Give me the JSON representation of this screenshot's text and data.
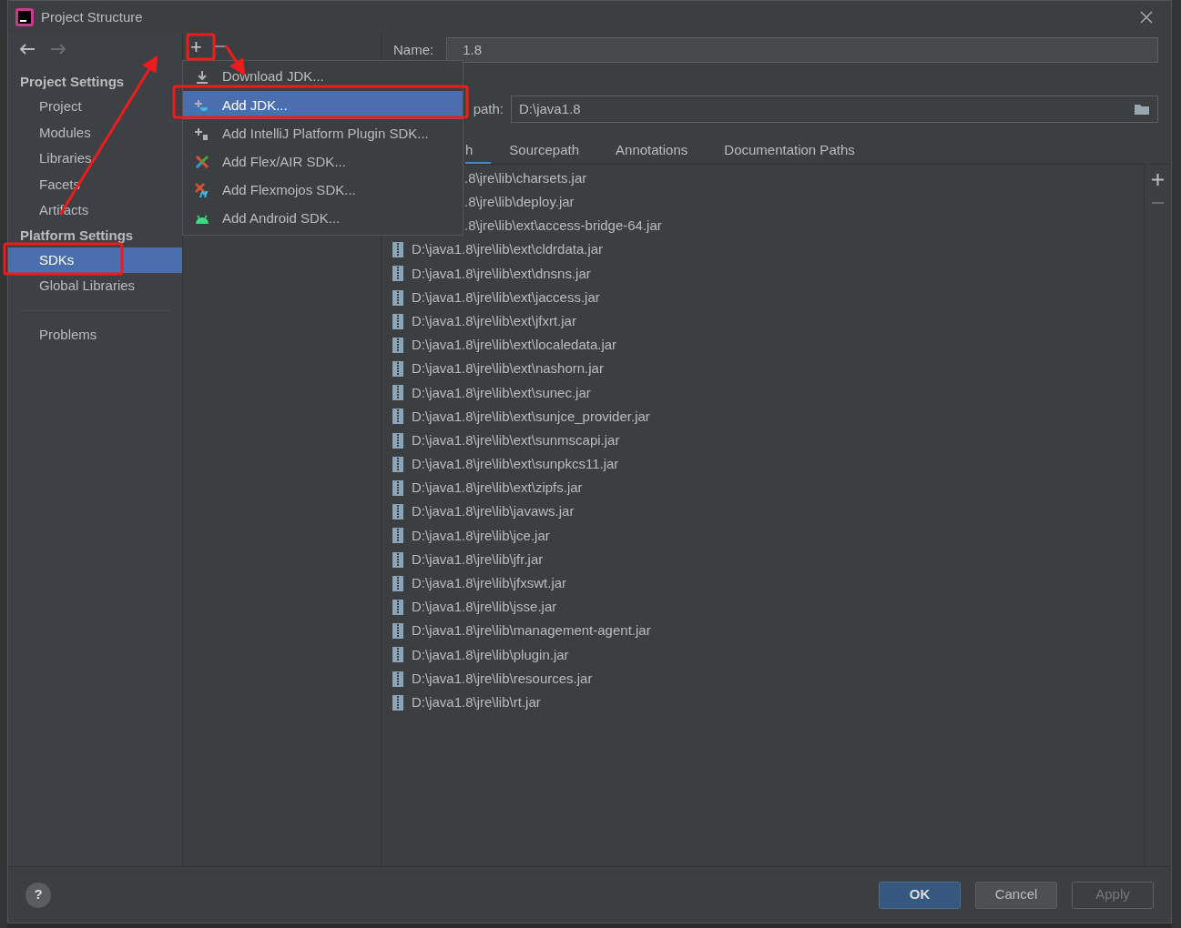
{
  "window": {
    "title": "Project Structure"
  },
  "sidebar": {
    "sections": [
      {
        "title": "Project Settings",
        "items": [
          {
            "label": "Project",
            "selected": false
          },
          {
            "label": "Modules",
            "selected": false
          },
          {
            "label": "Libraries",
            "selected": false
          },
          {
            "label": "Facets",
            "selected": false
          },
          {
            "label": "Artifacts",
            "selected": false
          }
        ]
      },
      {
        "title": "Platform Settings",
        "items": [
          {
            "label": "SDKs",
            "selected": true
          },
          {
            "label": "Global Libraries",
            "selected": false
          }
        ]
      }
    ],
    "bottom_items": [
      {
        "label": "Problems",
        "selected": false
      }
    ]
  },
  "toolbar": {
    "add": "+"
  },
  "add_menu": [
    {
      "label": "Download JDK...",
      "kind": "download",
      "selected": false
    },
    {
      "label": "Add JDK...",
      "kind": "jdk",
      "selected": true
    },
    {
      "label": "Add IntelliJ Platform Plugin SDK...",
      "kind": "plugin",
      "selected": false
    },
    {
      "label": "Add Flex/AIR SDK...",
      "kind": "flex",
      "selected": false
    },
    {
      "label": "Add Flexmojos SDK...",
      "kind": "flexmojos",
      "selected": false
    },
    {
      "label": "Add Android SDK...",
      "kind": "android",
      "selected": false
    }
  ],
  "help": "?",
  "sdk": {
    "name_label": "Name:",
    "name": "1.8",
    "path_label": "path:",
    "path": "D:\\java1.8"
  },
  "tabs": [
    {
      "label": "h",
      "selected": true
    },
    {
      "label": "Sourcepath",
      "selected": false
    },
    {
      "label": "Annotations",
      "selected": false
    },
    {
      "label": "Documentation Paths",
      "selected": false
    }
  ],
  "classpath": [
    {
      "kind": "clipped",
      "path": ".8\\jre\\lib\\charsets.jar"
    },
    {
      "kind": "clipped",
      "path": ".8\\jre\\lib\\deploy.jar"
    },
    {
      "kind": "clipped",
      "path": ".8\\jre\\lib\\ext\\access-bridge-64.jar"
    },
    {
      "kind": "full",
      "path": "D:\\java1.8\\jre\\lib\\ext\\cldrdata.jar"
    },
    {
      "kind": "full",
      "path": "D:\\java1.8\\jre\\lib\\ext\\dnsns.jar"
    },
    {
      "kind": "full",
      "path": "D:\\java1.8\\jre\\lib\\ext\\jaccess.jar"
    },
    {
      "kind": "full",
      "path": "D:\\java1.8\\jre\\lib\\ext\\jfxrt.jar"
    },
    {
      "kind": "full",
      "path": "D:\\java1.8\\jre\\lib\\ext\\localedata.jar"
    },
    {
      "kind": "full",
      "path": "D:\\java1.8\\jre\\lib\\ext\\nashorn.jar"
    },
    {
      "kind": "full",
      "path": "D:\\java1.8\\jre\\lib\\ext\\sunec.jar"
    },
    {
      "kind": "full",
      "path": "D:\\java1.8\\jre\\lib\\ext\\sunjce_provider.jar"
    },
    {
      "kind": "full",
      "path": "D:\\java1.8\\jre\\lib\\ext\\sunmscapi.jar"
    },
    {
      "kind": "full",
      "path": "D:\\java1.8\\jre\\lib\\ext\\sunpkcs11.jar"
    },
    {
      "kind": "full",
      "path": "D:\\java1.8\\jre\\lib\\ext\\zipfs.jar"
    },
    {
      "kind": "full",
      "path": "D:\\java1.8\\jre\\lib\\javaws.jar"
    },
    {
      "kind": "full",
      "path": "D:\\java1.8\\jre\\lib\\jce.jar"
    },
    {
      "kind": "full",
      "path": "D:\\java1.8\\jre\\lib\\jfr.jar"
    },
    {
      "kind": "full",
      "path": "D:\\java1.8\\jre\\lib\\jfxswt.jar"
    },
    {
      "kind": "full",
      "path": "D:\\java1.8\\jre\\lib\\jsse.jar"
    },
    {
      "kind": "full",
      "path": "D:\\java1.8\\jre\\lib\\management-agent.jar"
    },
    {
      "kind": "full",
      "path": "D:\\java1.8\\jre\\lib\\plugin.jar"
    },
    {
      "kind": "full",
      "path": "D:\\java1.8\\jre\\lib\\resources.jar"
    },
    {
      "kind": "full",
      "path": "D:\\java1.8\\jre\\lib\\rt.jar"
    }
  ],
  "buttons": [
    {
      "label": "OK",
      "kind": "default",
      "disabled": false
    },
    {
      "label": "Cancel",
      "kind": "normal",
      "disabled": false
    },
    {
      "label": "Apply",
      "kind": "normal",
      "disabled": true
    }
  ]
}
